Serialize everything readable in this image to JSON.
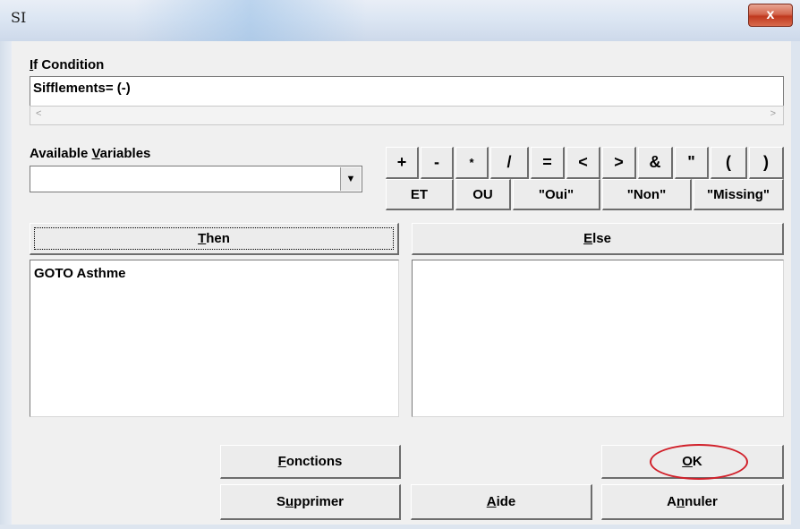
{
  "window": {
    "title": "SI",
    "close_glyph": "x"
  },
  "if_condition": {
    "label_underlined": "I",
    "label_rest": "f Condition",
    "value": "Sifflements= (-)",
    "scroll_left": "<",
    "scroll_right": ">"
  },
  "available_variables": {
    "label_pre": "Available ",
    "label_underlined": "V",
    "label_post": "ariables",
    "value": "",
    "dropdown_glyph": "▼"
  },
  "operators": [
    "+",
    "-",
    "*",
    "/",
    "=",
    "<",
    ">",
    "&",
    "\"",
    "(",
    ")"
  ],
  "logic_buttons": [
    "ET",
    "OU",
    "\"Oui\"",
    "\"Non\"",
    "\"Missing\""
  ],
  "then": {
    "label_underlined": "T",
    "label_rest": "hen",
    "content": "GOTO  Asthme"
  },
  "else": {
    "label_underlined": "E",
    "label_rest": "lse",
    "content": ""
  },
  "buttons": {
    "fonctions": {
      "u": "F",
      "rest": "onctions"
    },
    "ok": {
      "u": "O",
      "rest": "K"
    },
    "supprimer": {
      "pre": "S",
      "u": "u",
      "rest": "pprimer"
    },
    "aide": {
      "u": "A",
      "rest": "ide"
    },
    "annuler": {
      "pre": "A",
      "u": "n",
      "rest": "nuler"
    }
  },
  "highlight_color": "#d1202a"
}
